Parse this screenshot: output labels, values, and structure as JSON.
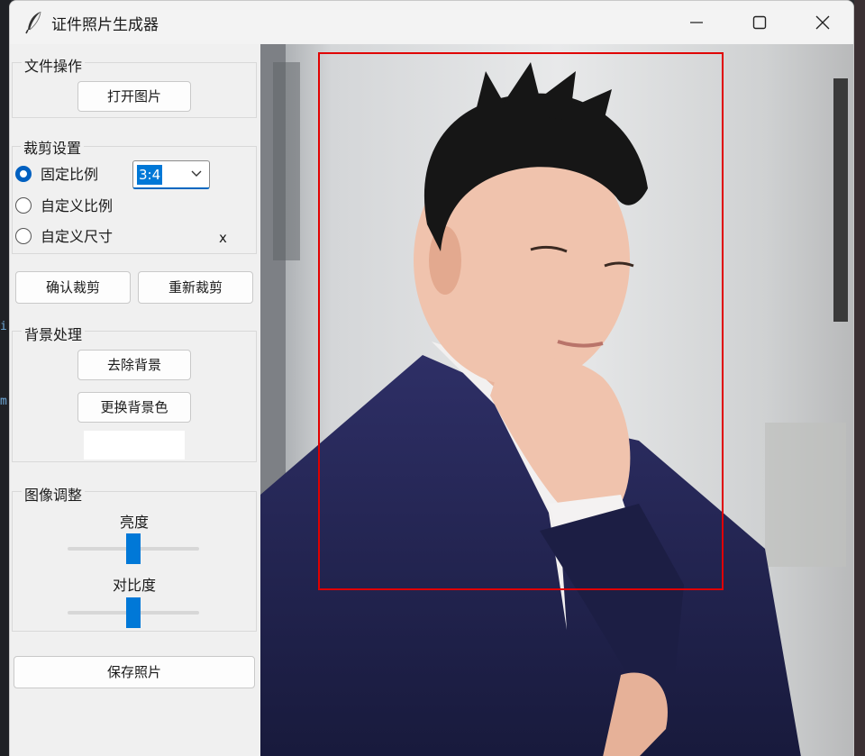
{
  "window": {
    "title": "证件照片生成器"
  },
  "file_group": {
    "title": "文件操作",
    "open_button": "打开图片"
  },
  "crop_group": {
    "title": "裁剪设置",
    "options": [
      {
        "label": "固定比例",
        "selected": true
      },
      {
        "label": "自定义比例",
        "selected": false
      },
      {
        "label": "自定义尺寸",
        "selected": false
      }
    ],
    "ratio_value": "3:4",
    "size_separator": "x",
    "confirm_button": "确认裁剪",
    "reset_button": "重新裁剪"
  },
  "background_group": {
    "title": "背景处理",
    "remove_button": "去除背景",
    "change_color_button": "更换背景色",
    "selected_color": "#ffffff"
  },
  "adjust_group": {
    "title": "图像调整",
    "brightness_label": "亮度",
    "brightness_level": 0.5,
    "contrast_label": "对比度",
    "contrast_level": 0.5
  },
  "save_button": "保存照片",
  "colors": {
    "accent": "#0078d7",
    "crop_border": "#e00000"
  },
  "icons": {
    "app": "feather-icon",
    "minimize": "minimize-icon",
    "maximize": "maximize-icon",
    "close": "close-icon",
    "dropdown": "chevron-down-icon"
  }
}
